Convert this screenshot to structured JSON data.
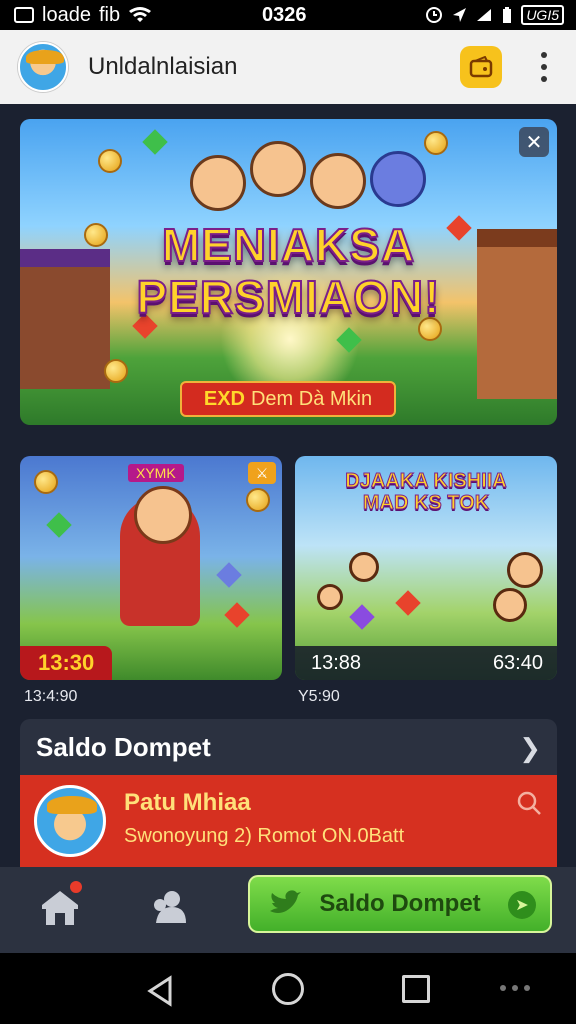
{
  "status_bar": {
    "carrier": "loade",
    "carrier_extra": "fib",
    "time": "0326",
    "battery_text": "UGI5"
  },
  "app_bar": {
    "title": "Unldalnlaisian",
    "wallet_icon": "wallet-icon",
    "menu_icon": "more-vert-icon"
  },
  "hero_banner": {
    "headline_line1": "MENIAKSA",
    "headline_line2": "PERSMIAON!",
    "cta_prefix": "EXD",
    "cta_label": "Dem Dà Mkin",
    "close_icon": "close-icon"
  },
  "game_cards": [
    {
      "tag": "XYMK",
      "timer": "13:30",
      "caption": "13:4:90",
      "badge_icon": "crossed-swords-icon"
    },
    {
      "title_line1": "DJAAKA KISHIIA",
      "title_line2": "MAD KS TOK",
      "timer": "13:88",
      "count": "63:40",
      "caption": "Y5:90"
    }
  ],
  "wallet": {
    "header": "Saldo Dompet",
    "user_name": "Patu Mhiaa",
    "detail": "Swonoyung 2) Romot ON.0Batt",
    "chevron_icon": "chevron-right-icon",
    "search_icon": "search-icon"
  },
  "bottom_nav": {
    "home_icon": "home-icon",
    "friends_icon": "users-icon",
    "primary_button": "Saldo Dompet",
    "primary_icon": "twitter-bird-icon",
    "arrow_icon": "arrow-right-icon"
  },
  "colors": {
    "accent_red": "#d63020",
    "accent_green": "#43b02a",
    "accent_yellow": "#ffd22b",
    "panel_dark": "#2b3140"
  }
}
